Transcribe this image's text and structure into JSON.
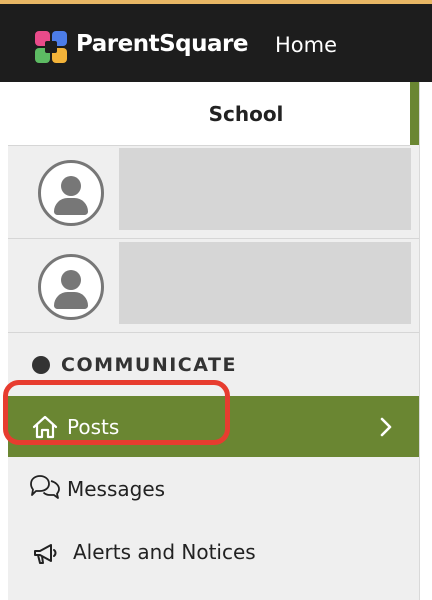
{
  "header": {
    "brand": "ParentSquare",
    "home_link": "Home",
    "logo_colors": [
      "#e94b8a",
      "#4c7de8",
      "#5dbb63",
      "#f3b339"
    ]
  },
  "sidebar": {
    "school_tab": "School",
    "section_header": "COMMUNICATE",
    "nav_items": [
      {
        "label": "Posts",
        "icon": "home-icon",
        "active": true
      },
      {
        "label": "Messages",
        "icon": "chat-bubbles-icon",
        "active": false
      },
      {
        "label": "Alerts and Notices",
        "icon": "megaphone-icon",
        "active": false
      }
    ]
  },
  "colors": {
    "accent_green": "#6a8632",
    "highlight_red": "#e73c2f",
    "header_dark": "#1d1d1d"
  }
}
